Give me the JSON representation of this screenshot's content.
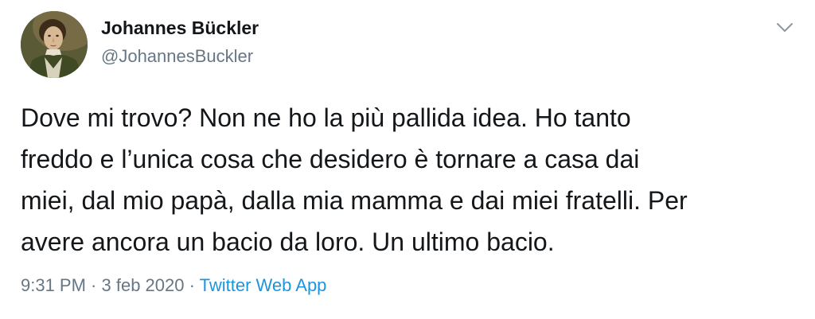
{
  "author": {
    "name": "Johannes Bückler",
    "handle": "@JohannesBuckler"
  },
  "tweet": {
    "lines": [
      "Dove mi trovo? Non ne ho la più pallida idea. Ho tanto",
      "freddo e l’unica cosa che desidero è tornare a casa dai",
      "miei, dal mio papà, dalla mia mamma e dai miei fratelli. Per",
      "avere ancora un bacio da loro. Un ultimo bacio."
    ]
  },
  "meta": {
    "time": "9:31 PM",
    "separator1": " · ",
    "date": "3 feb 2020",
    "separator2": " · ",
    "source": "Twitter Web App"
  },
  "icons": {
    "menu": "chevron-down-icon",
    "avatar": "avatar-portrait"
  },
  "colors": {
    "text": "#14171a",
    "secondary": "#657786",
    "link": "#1b95e0"
  }
}
